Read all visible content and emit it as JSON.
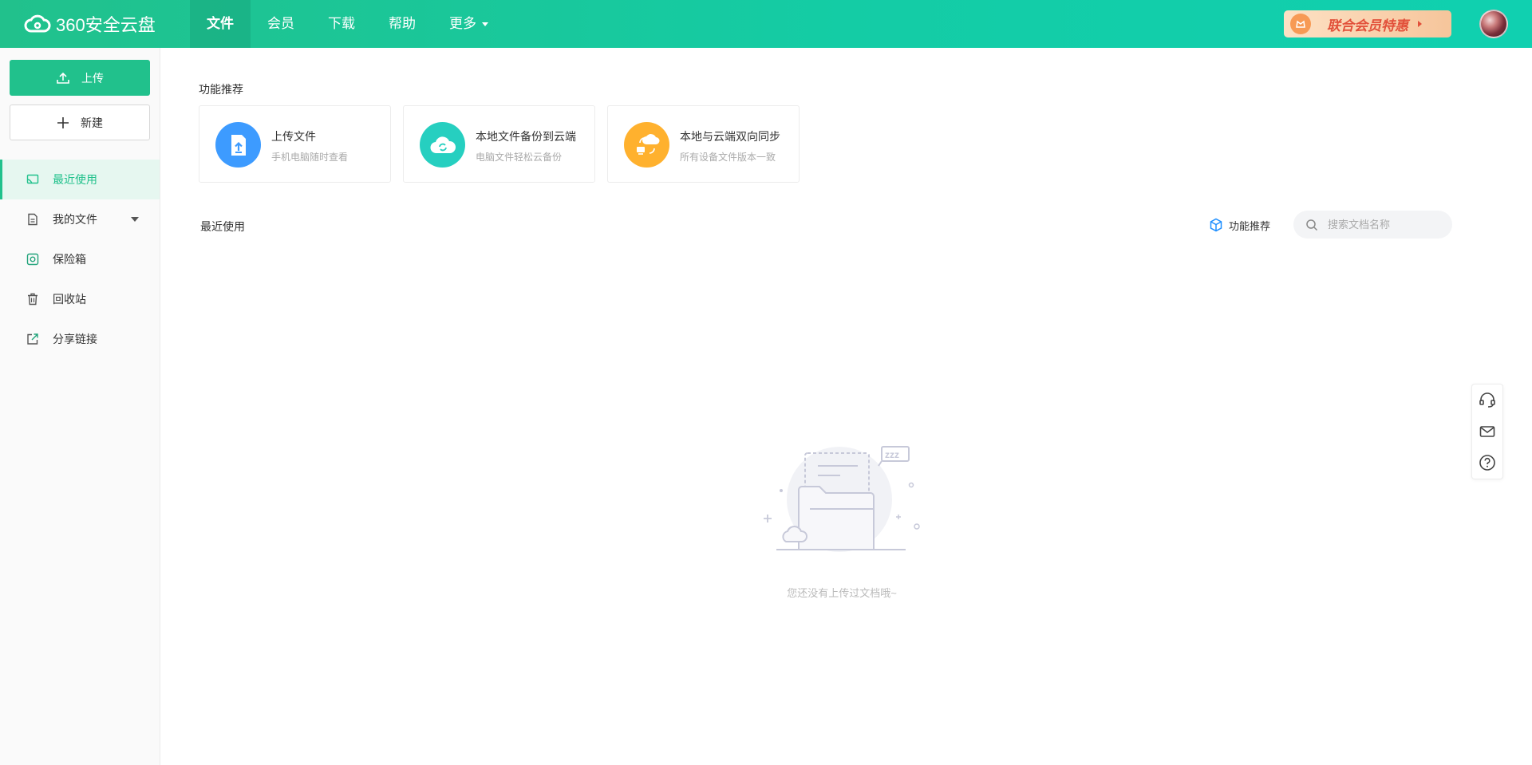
{
  "header": {
    "logo_text": "360安全云盘",
    "nav": [
      {
        "label": "文件",
        "active": true
      },
      {
        "label": "会员",
        "active": false
      },
      {
        "label": "下载",
        "active": false
      },
      {
        "label": "帮助",
        "active": false
      },
      {
        "label": "更多",
        "active": false,
        "has_dropdown": true
      }
    ],
    "promo_label": "联合会员特惠",
    "brand_color": "#21c18c"
  },
  "sidebar": {
    "upload_label": "上传",
    "new_label": "新建",
    "items": [
      {
        "label": "最近使用",
        "icon": "recent-icon",
        "active": true
      },
      {
        "label": "我的文件",
        "icon": "my-files-icon",
        "active": false,
        "expandable": true
      },
      {
        "label": "保险箱",
        "icon": "safe-icon",
        "active": false
      },
      {
        "label": "回收站",
        "icon": "trash-icon",
        "active": false
      },
      {
        "label": "分享链接",
        "icon": "share-icon",
        "active": false
      }
    ]
  },
  "main": {
    "feature_section_title": "功能推荐",
    "feature_cards": [
      {
        "title": "上传文件",
        "subtitle": "手机电脑随时查看",
        "icon": "upload-file-icon",
        "color": "#3d9bff"
      },
      {
        "title": "本地文件备份到云端",
        "subtitle": "电脑文件轻松云备份",
        "icon": "cloud-backup-icon",
        "color": "#26cfc0"
      },
      {
        "title": "本地与云端双向同步",
        "subtitle": "所有设备文件版本一致",
        "icon": "sync-icon",
        "color": "#ffb12e"
      }
    ],
    "recent_section_title": "最近使用",
    "feature_link_label": "功能推荐",
    "search": {
      "placeholder": "搜索文档名称",
      "value": ""
    },
    "empty_text": "您还没有上传过文档哦~"
  },
  "float_toolbar": {
    "items": [
      "customer-service-icon",
      "mail-icon",
      "help-icon"
    ]
  }
}
